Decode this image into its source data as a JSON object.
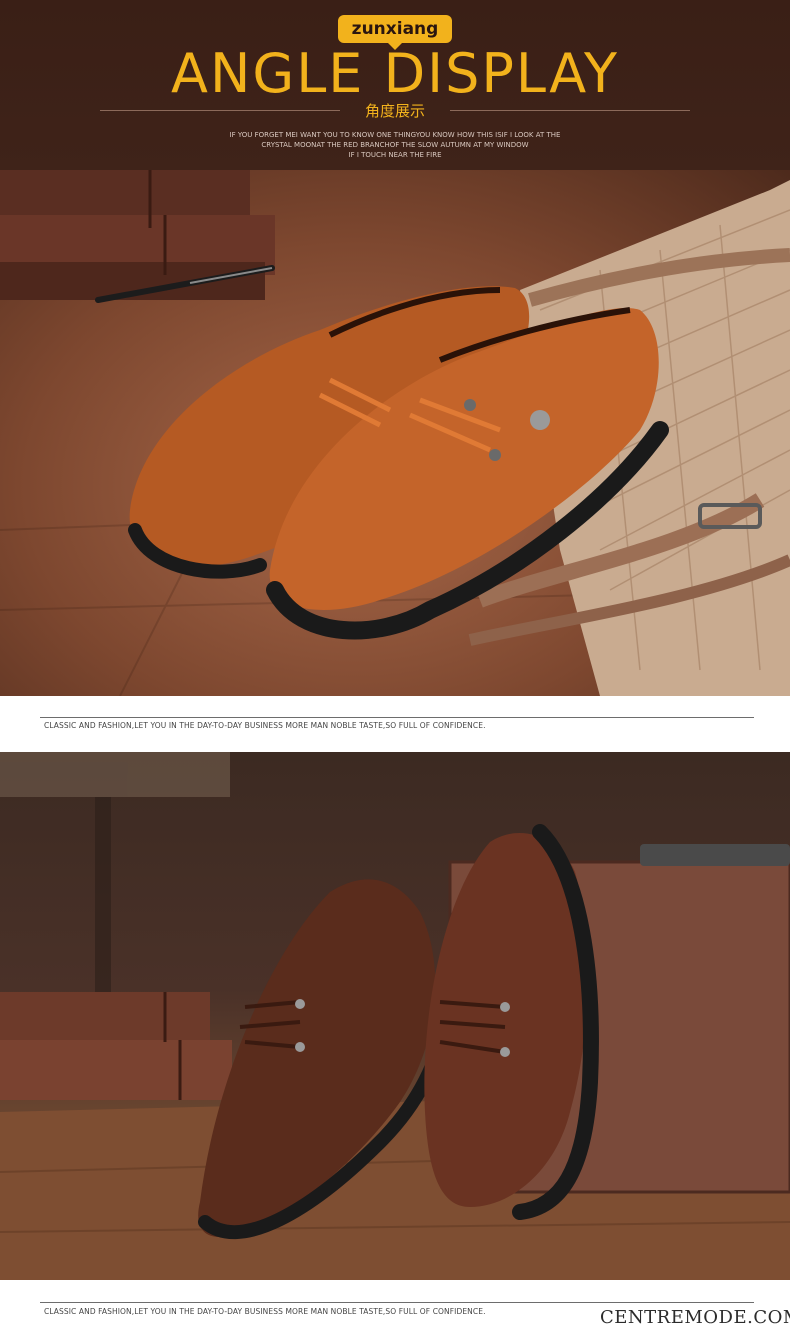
{
  "header": {
    "brand": "zunxiang",
    "title": "ANGLE DISPLAY",
    "subtitle_cn": "角度展示",
    "tagline_lines": [
      "IF YOU FORGET MEI WANT YOU TO KNOW ONE THINGYOU KNOW HOW THIS ISIF I LOOK AT THE",
      "CRYSTAL MOONAT THE RED BRANCHOF THE SLOW AUTUMN AT MY WINDOW",
      "IF I TOUCH NEAR THE FIRE"
    ]
  },
  "photos": [
    {
      "subject": "tan leather lace-up shoes beside patterned handbag",
      "shoe_color": "#b55a23"
    },
    {
      "subject": "brown leather lace-up shoes beside wooden case",
      "shoe_color": "#5a2c1c"
    }
  ],
  "captions": {
    "first": "CLASSIC AND FASHION,LET YOU IN THE DAY-TO-DAY BUSINESS MORE MAN NOBLE TASTE,SO FULL OF CONFIDENCE.",
    "second": "CLASSIC AND FASHION,LET YOU IN THE DAY-TO-DAY BUSINESS MORE MAN NOBLE TASTE,SO FULL OF CONFIDENCE."
  },
  "watermark": "CENTREMODE.COM",
  "colors": {
    "header_bg": "#3b2017",
    "accent": "#f2b21c"
  }
}
